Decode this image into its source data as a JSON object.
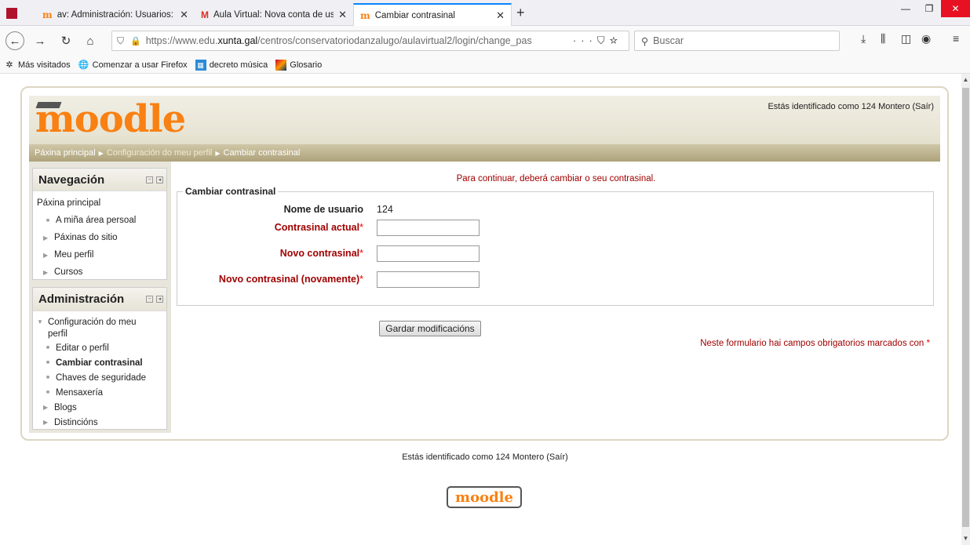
{
  "browser": {
    "tabs": [
      {
        "label": "av: Administración: Usuarios: C",
        "favicon": "moodle-favicon"
      },
      {
        "label": "Aula Virtual: Nova conta de usu",
        "favicon": "gmail-favicon"
      },
      {
        "label": "Cambiar contrasinal",
        "favicon": "moodle-favicon"
      }
    ],
    "url_prefix": "https://www.edu.",
    "url_domain": "xunta.gal",
    "url_suffix": "/centros/conservatoriodanzalugo/aulavirtual2/login/change_pas",
    "search_placeholder": "Buscar",
    "bookmarks": [
      "Más visitados",
      "Comenzar a usar Firefox",
      "decreto música",
      "Glosario"
    ]
  },
  "header": {
    "logo_text": "moodle",
    "user_prefix": "Estás identificado como ",
    "user_name": "124 Montero",
    "logout": "(Saír)"
  },
  "breadcrumb": {
    "items": [
      "Páxina principal",
      "Configuración do meu perfil",
      "Cambiar contrasinal"
    ]
  },
  "navigation": {
    "title": "Navegación",
    "items": [
      "Páxina principal",
      "A miña área persoal",
      "Páxinas do sitio",
      "Meu perfil",
      "Cursos"
    ]
  },
  "administration": {
    "title": "Administración",
    "parent": "Configuración do meu perfil",
    "items": [
      "Editar o perfil",
      "Cambiar contrasinal",
      "Chaves de seguridade",
      "Mensaxería",
      "Blogs",
      "Distincións"
    ]
  },
  "form": {
    "notice": "Para continuar, deberá cambiar o seu contrasinal.",
    "legend": "Cambiar contrasinal",
    "username_label": "Nome de usuario",
    "username_value": "124",
    "current_label": "Contrasinal actual",
    "new_label": "Novo contrasinal",
    "new_again_label": "Novo contrasinal (novamente)",
    "required_mark": "*",
    "save_label": "Gardar modificacións",
    "required_note": "Neste formulario hai campos obrigatorios marcados con "
  },
  "footer": {
    "user_text": "Estás identificado como 124 Montero (Saír)",
    "logo_text": "moodle"
  },
  "colors": {
    "accent": "#f98012",
    "required": "#a00000",
    "breadcrumb": "#aea27a"
  }
}
